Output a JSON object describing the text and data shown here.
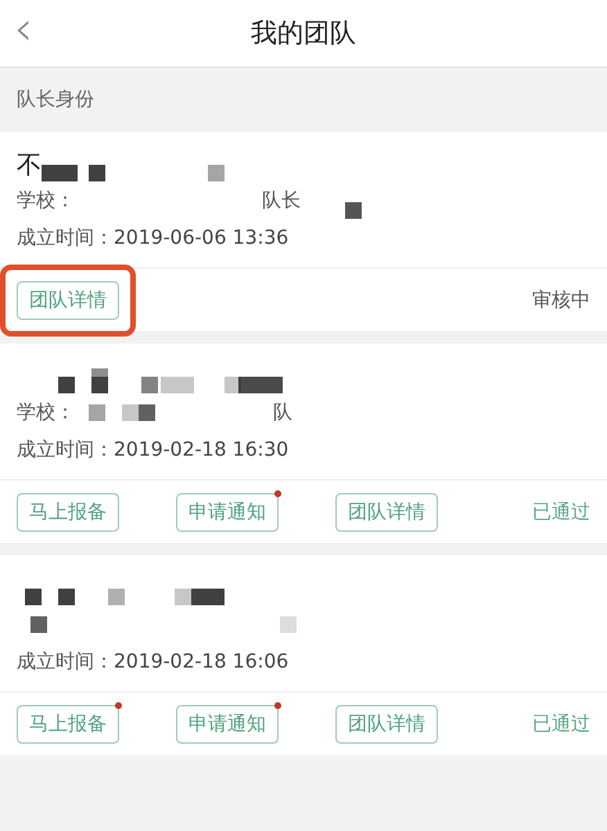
{
  "header": {
    "back_icon": "‹",
    "title": "我的团队"
  },
  "section": {
    "title": "队长身份"
  },
  "teams": [
    {
      "name": "不",
      "school_label": "学校：",
      "role": "队长",
      "founded_label": "成立时间：",
      "founded": "2019-06-06 13:36",
      "buttons": [
        {
          "label": "团队详情",
          "dot": false,
          "highlighted": true
        }
      ],
      "status": "审核中",
      "color": "#555555"
    },
    {
      "school_label": "学校：",
      "role": "队",
      "founded_label": "成立时间：",
      "founded": "2019-02-18 16:30",
      "buttons": [
        {
          "label": "马上报备",
          "dot": false,
          "highlighted": false
        },
        {
          "label": "申请通知",
          "dot": true,
          "highlighted": false
        },
        {
          "label": "团队详情",
          "dot": false,
          "highlighted": false
        }
      ],
      "status": "已通过",
      "color": "#5aa885"
    },
    {
      "founded_label": "成立时间：",
      "founded": "2019-02-18 16:06",
      "buttons": [
        {
          "label": "马上报备",
          "dot": true,
          "highlighted": false
        },
        {
          "label": "申请通知",
          "dot": true,
          "highlighted": false
        },
        {
          "label": "团队详情",
          "dot": false,
          "highlighted": false
        }
      ],
      "status": "已通过",
      "color": "#5aa885"
    }
  ]
}
